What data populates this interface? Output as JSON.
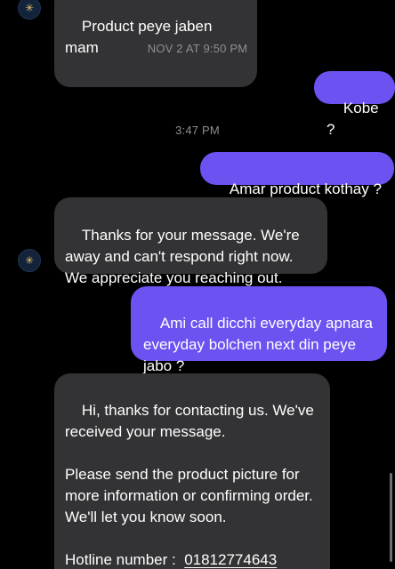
{
  "messages": [
    {
      "id": "m1",
      "direction": "incoming",
      "text": "Product peye jaben mam"
    },
    {
      "id": "m2",
      "direction": "outgoing",
      "text": "Kobe ?"
    },
    {
      "id": "m3",
      "direction": "outgoing",
      "text": "Amar product kothay ?"
    },
    {
      "id": "m4",
      "direction": "incoming",
      "text": "Thanks for your message. We're away and can't respond right now. We appreciate you reaching out."
    },
    {
      "id": "m5",
      "direction": "outgoing",
      "text": "Ami call dicchi everyday apnara everyday bolchen next din peye jabo ?"
    },
    {
      "id": "m6",
      "direction": "incoming",
      "text": "Hi, thanks for contacting us. We've received your message.\n\nPlease send the product picture for more information or confirming order. We'll let you know soon.\n\n",
      "hotline_label": "Hotline number :  ",
      "hotline_number": "01812774643"
    }
  ],
  "timestamps": {
    "first": "NOV 2 AT 9:50 PM",
    "second": "3:47 PM"
  },
  "avatar": {
    "icon": "star-icon",
    "glyph": "✳"
  },
  "colors": {
    "background": "#000000",
    "incoming_bubble": "#333335",
    "outgoing_bubble": "#6b52f1",
    "timestamp_text": "#8e8e93"
  }
}
